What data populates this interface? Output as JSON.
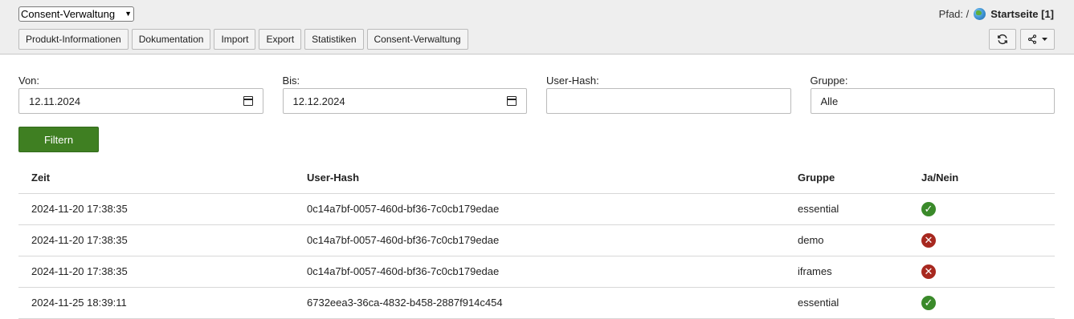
{
  "toolbar": {
    "module_select": "Consent-Verwaltung",
    "buttons": [
      {
        "label": "Produkt-Informationen"
      },
      {
        "label": "Dokumentation"
      },
      {
        "label": "Import"
      },
      {
        "label": "Export"
      },
      {
        "label": "Statistiken"
      },
      {
        "label": "Consent-Verwaltung"
      }
    ],
    "path_label": "Pfad: /",
    "path_page": "Startseite [1]"
  },
  "filters": {
    "from_label": "Von:",
    "from_value": "12.11.2024",
    "to_label": "Bis:",
    "to_value": "12.12.2024",
    "hash_label": "User-Hash:",
    "hash_value": "",
    "group_label": "Gruppe:",
    "group_value": "Alle",
    "submit_label": "Filtern"
  },
  "table": {
    "headers": {
      "zeit": "Zeit",
      "hash": "User-Hash",
      "gruppe": "Gruppe",
      "status": "Ja/Nein"
    },
    "rows": [
      {
        "zeit": "2024-11-20 17:38:35",
        "hash": "0c14a7bf-0057-460d-bf36-7c0cb179edae",
        "gruppe": "essential",
        "accepted": true
      },
      {
        "zeit": "2024-11-20 17:38:35",
        "hash": "0c14a7bf-0057-460d-bf36-7c0cb179edae",
        "gruppe": "demo",
        "accepted": false
      },
      {
        "zeit": "2024-11-20 17:38:35",
        "hash": "0c14a7bf-0057-460d-bf36-7c0cb179edae",
        "gruppe": "iframes",
        "accepted": false
      },
      {
        "zeit": "2024-11-25 18:39:11",
        "hash": "6732eea3-36ca-4832-b458-2887f914c454",
        "gruppe": "essential",
        "accepted": true
      }
    ]
  },
  "colors": {
    "accept": "#3a8a2a",
    "reject": "#a7281f",
    "filter_button": "#3f7f22"
  },
  "icons": {
    "refresh": "refresh-icon",
    "share": "share-icon",
    "globe": "globe-icon",
    "accept": "check-circle-icon",
    "reject": "x-circle-icon"
  }
}
